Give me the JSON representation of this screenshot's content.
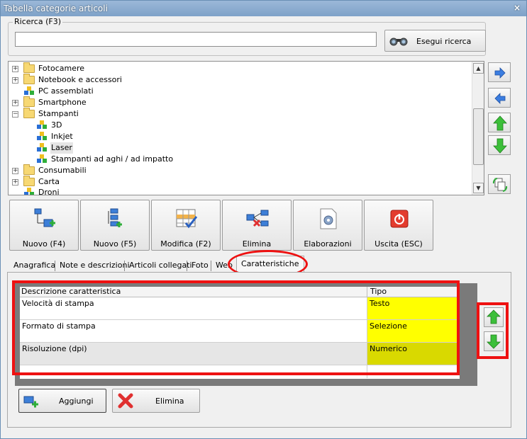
{
  "window": {
    "title": "Tabella categorie articoli",
    "close_glyph": "×"
  },
  "search": {
    "group_label": "Ricerca (F3)",
    "value": "",
    "placeholder": "",
    "button_label": "Esegui ricerca",
    "button_icon": "binoculars-icon"
  },
  "tree": {
    "items": [
      {
        "label": "Fotocamere",
        "type": "folder",
        "expander": "+"
      },
      {
        "label": "Notebook e accessori",
        "type": "folder",
        "expander": "+"
      },
      {
        "label": "PC assemblati",
        "type": "node"
      },
      {
        "label": "Smartphone",
        "type": "folder",
        "expander": "+"
      },
      {
        "label": "Stampanti",
        "type": "folder",
        "expander": "−"
      },
      {
        "label": "3D",
        "type": "node"
      },
      {
        "label": "Inkjet",
        "type": "node"
      },
      {
        "label": "Laser",
        "type": "node",
        "selected": true
      },
      {
        "label": "Stampanti ad aghi / ad impatto",
        "type": "node"
      },
      {
        "label": "Consumabili",
        "type": "folder",
        "expander": "+"
      },
      {
        "label": "Carta",
        "type": "folder",
        "expander": "+"
      },
      {
        "label": "Droni",
        "type": "node"
      }
    ],
    "scroll_up_glyph": "▲",
    "scroll_down_glyph": "▼"
  },
  "side_nav": [
    "arrow-right-icon",
    "arrow-left-icon",
    "arrow-up-icon",
    "arrow-down-icon",
    "refresh-icon"
  ],
  "toolbar": {
    "nuovo_f4": "Nuovo (F4)",
    "nuovo_f5": "Nuovo (F5)",
    "modifica": "Modifica (F2)",
    "elimina": "Elimina",
    "elaborazioni": "Elaborazioni",
    "uscita": "Uscita (ESC)"
  },
  "tabs": {
    "anagrafica": "Anagrafica",
    "note": "Note e descrizioni",
    "articoli": "Articoli collegati",
    "foto": "Foto",
    "web": "Web",
    "caratteristiche": "Caratteristiche"
  },
  "grid": {
    "col_desc": "Descrizione caratteristica",
    "col_tipo": "Tipo",
    "rows": [
      {
        "desc": "Velocità di stampa",
        "tipo": "Testo"
      },
      {
        "desc": "Formato di stampa",
        "tipo": "Selezione"
      },
      {
        "desc": "Risoluzione (dpi)",
        "tipo": "Numerico"
      }
    ]
  },
  "bottom": {
    "aggiungi": "Aggiungi",
    "elimina": "Elimina"
  },
  "colors": {
    "highlight": "#ee1111",
    "tipo_cell": "#ffff00",
    "title_bar": "#7ea2c8"
  }
}
